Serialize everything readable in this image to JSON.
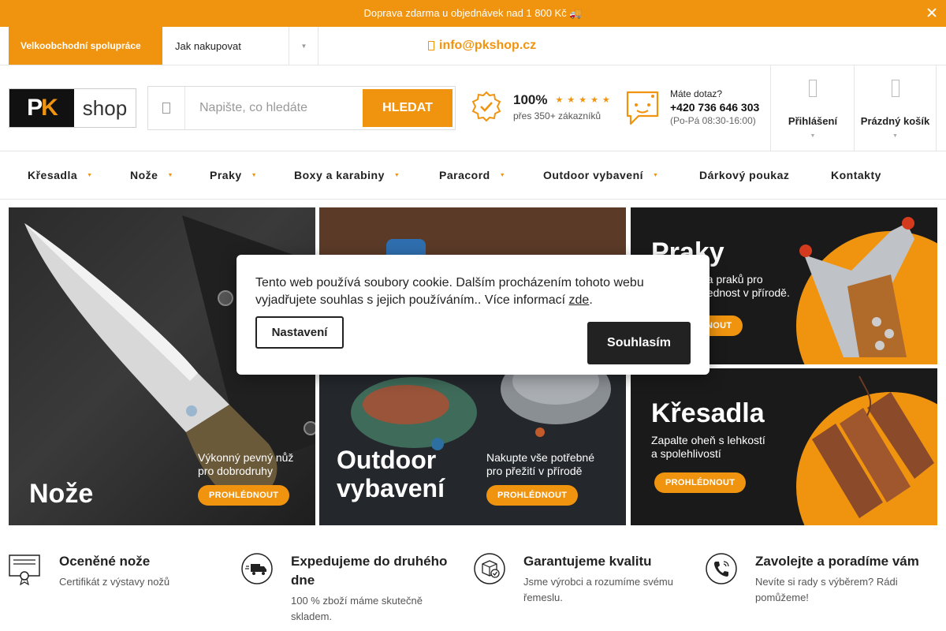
{
  "topbar": {
    "text": "Doprava zdarma u objednávek nad 1 800 Kč 🚚"
  },
  "utility": {
    "wholesale": "Velkoobchodní spolupráce",
    "howto": "Jak nakupovat",
    "email": "info@pkshop.cz"
  },
  "logo": {
    "mark_p": "P",
    "mark_k": "K",
    "word": "shop"
  },
  "search": {
    "placeholder": "Napište, co hledáte",
    "button": "HLEDAT"
  },
  "rating": {
    "percent": "100%",
    "stars": "★★★★★",
    "sub": "přes 350+ zákazníků"
  },
  "contact": {
    "question": "Máte dotaz?",
    "phone": "+420 736 646 303",
    "hours": "(Po-Pá 08:30-16:00)"
  },
  "account": {
    "login": "Přihlášení",
    "cart": "Prázdný košík"
  },
  "nav": [
    {
      "label": "Křesadla",
      "dropdown": true
    },
    {
      "label": "Nože",
      "dropdown": true
    },
    {
      "label": "Praky",
      "dropdown": true
    },
    {
      "label": "Boxy a karabiny",
      "dropdown": true
    },
    {
      "label": "Paracord",
      "dropdown": true
    },
    {
      "label": "Outdoor vybavení",
      "dropdown": true
    },
    {
      "label": "Dárkový poukaz",
      "dropdown": false
    },
    {
      "label": "Kontakty",
      "dropdown": false
    }
  ],
  "banners": {
    "knives": {
      "title": "Nože",
      "sub1": "Výkonný pevný nůž",
      "sub2": "pro dobrodruhy",
      "button": "PROHLÉDNOUT"
    },
    "outdoor": {
      "title1": "Outdoor",
      "title2": "vybavení",
      "sub1": "Nakupte vše potřebné",
      "sub2": "pro přežití v přírodě",
      "button": "PROHLÉDNOUT"
    },
    "praky": {
      "title": "Praky",
      "sub1": "dka praků pro",
      "sub2": "ovednost v přírodě.",
      "button": "NOUT"
    },
    "kresadla": {
      "title": "Křesadla",
      "sub1": "Zapalte oheň s lehkostí",
      "sub2": "a spolehlivostí",
      "button": "PROHLÉDNOUT"
    }
  },
  "cookie": {
    "message": "Tento web používá soubory cookie. Dalším procházením tohoto webu vyjadřujete souhlas s jejich používáním.. Více informací ",
    "link": "zde",
    "after": ".",
    "settings": "Nastavení",
    "agree": "Souhlasím"
  },
  "features": [
    {
      "icon": "certificate-icon",
      "title": "Oceněné nože",
      "text": "Certifikát z výstavy nožů"
    },
    {
      "icon": "delivery-truck-icon",
      "title": "Expedujeme do druhého dne",
      "text": "100 % zboží máme skutečně skladem."
    },
    {
      "icon": "quality-box-icon",
      "title": "Garantujeme kvalitu",
      "text": "Jsme výrobci a rozumíme svému řemeslu."
    },
    {
      "icon": "phone-call-icon",
      "title": "Zavolejte a poradíme vám",
      "text": "Nevíte si rady s výběrem? Rádi pomůžeme!"
    }
  ],
  "colors": {
    "accent": "#f0940f",
    "dark": "#222222"
  }
}
